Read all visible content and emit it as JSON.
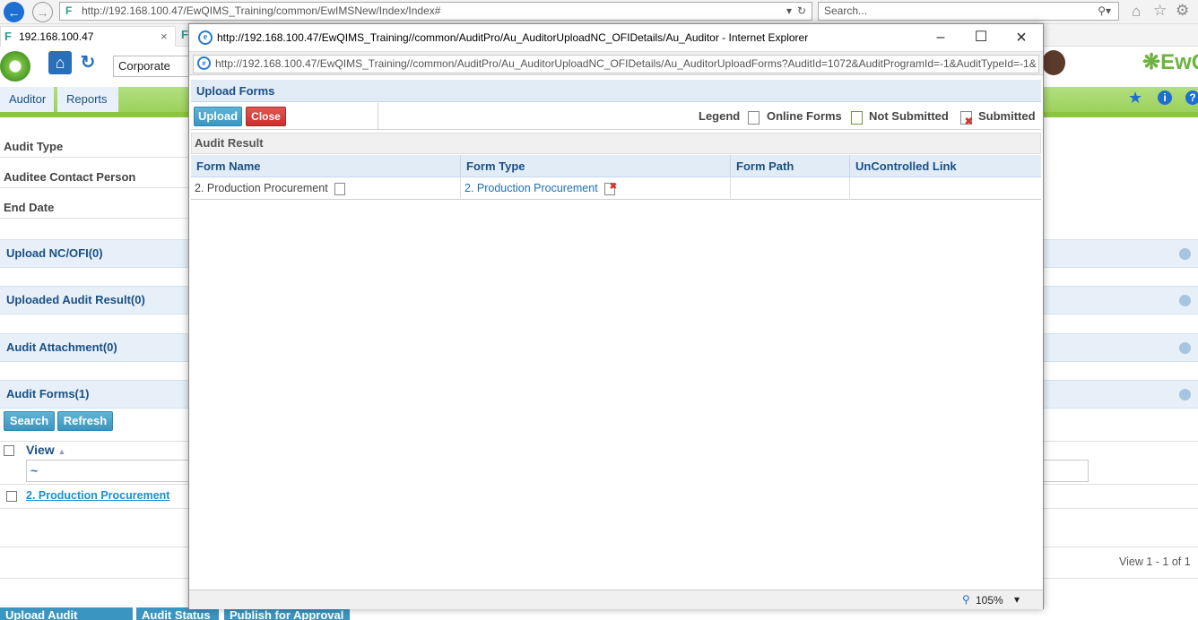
{
  "browser": {
    "url": "http://192.168.100.47/EwQIMS_Training/common/EwIMSNew/Index/Index#",
    "search_placeholder": "Search...",
    "tab_title": "192.168.100.47"
  },
  "app": {
    "location_select": "Corporate",
    "brand": "EwQ",
    "menu": [
      "Auditor",
      "Reports"
    ]
  },
  "form": {
    "fields": [
      "Audit Type",
      "Auditee Contact Person",
      "End Date"
    ]
  },
  "sections": {
    "upload_nc": "Upload NC/OFI(0)",
    "uploaded_result": "Uploaded Audit Result(0)",
    "attachment": "Audit Attachment(0)",
    "audit_forms": "Audit Forms(1)"
  },
  "audit_forms_grid": {
    "search_label": "Search",
    "refresh_label": "Refresh",
    "view_header": "View",
    "filter_value": "~",
    "row_link": "2. Production Procurement",
    "pager": "View 1 - 1 of 1"
  },
  "bottom_tabs": [
    "Upload Audit Records",
    "Audit Status",
    "Publish for Approval"
  ],
  "popup": {
    "title": "http://192.168.100.47/EwQIMS_Training//common/AuditPro/Au_AuditorUploadNC_OFIDetails/Au_Auditor - Internet Explorer",
    "url": "http://192.168.100.47/EwQIMS_Training//common/AuditPro/Au_AuditorUploadNC_OFIDetails/Au_AuditorUploadForms?AuditId=1072&AuditProgramId=-1&AuditTypeId=-1&",
    "header": "Upload Forms",
    "upload_label": "Upload",
    "close_label": "Close",
    "legend_label": "Legend",
    "legend_online": "Online Forms",
    "legend_not_submitted": "Not Submitted",
    "legend_submitted": "Submitted",
    "audit_result_label": "Audit Result",
    "columns": [
      "Form Name",
      "Form Type",
      "Form Path",
      "UnControlled Link"
    ],
    "row": {
      "form_name": "2. Production Procurement",
      "form_type": "2. Production Procurement"
    },
    "zoom": "105%"
  }
}
